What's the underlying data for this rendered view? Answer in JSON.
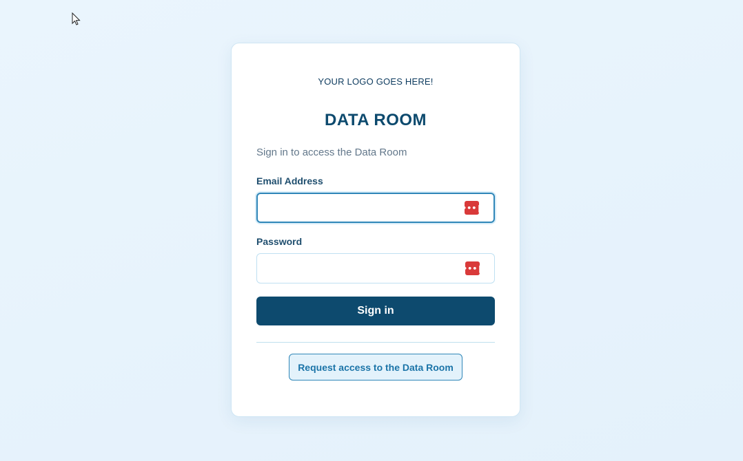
{
  "logo": {
    "text": "YOUR LOGO GOES HERE!"
  },
  "title": "DATA ROOM",
  "subtitle": "Sign in to access the Data Room",
  "form": {
    "email": {
      "label": "Email Address",
      "value": "",
      "placeholder": ""
    },
    "password": {
      "label": "Password",
      "value": "",
      "placeholder": ""
    },
    "password_manager_icon": "password-manager-icon",
    "signin_label": "Sign in"
  },
  "request_access_label": "Request access to the Data Room",
  "colors": {
    "primary": "#0d4a6e",
    "accent": "#2f86b8",
    "background": "#eaf5fd",
    "password_manager": "#d93a3a"
  }
}
